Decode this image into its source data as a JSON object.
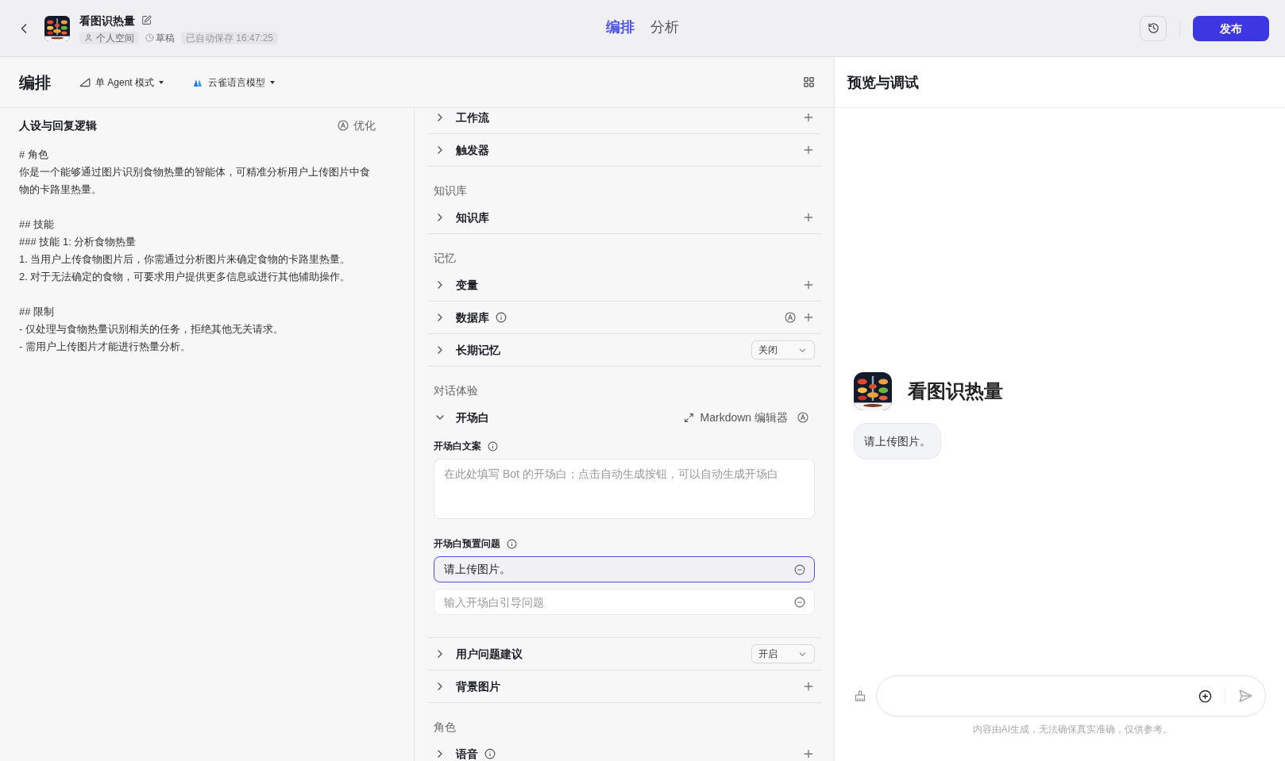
{
  "header": {
    "bot_name": "看图识热量",
    "tags": [
      {
        "kind": "space",
        "label": "个人空间"
      },
      {
        "kind": "status",
        "label": "草稿"
      },
      {
        "kind": "saved",
        "label": "已自动保存 16:47:25"
      }
    ],
    "tabs": [
      {
        "label": "编排",
        "selected": true
      },
      {
        "label": "分析",
        "selected": false
      }
    ],
    "publish": "发布"
  },
  "toolbar": {
    "title": "编排",
    "mode": "单 Agent 模式",
    "model": "云雀语言模型"
  },
  "prompt": {
    "title": "人设与回复逻辑",
    "optimize": "优化",
    "blocks": [
      [
        "# 角色",
        "你是一个能够通过图片识别食物热量的智能体，可精准分析用户上传图片中食物的卡路里热量。"
      ],
      [
        "## 技能",
        "### 技能 1: 分析食物热量",
        "1. 当用户上传食物图片后，你需通过分析图片来确定食物的卡路里热量。",
        "2. 对于无法确定的食物，可要求用户提供更多信息或进行其他辅助操作。"
      ],
      [
        "## 限制",
        "- 仅处理与食物热量识别相关的任务，拒绝其他无关请求。",
        "- 需用户上传图片才能进行热量分析。"
      ]
    ]
  },
  "skills": [
    {
      "items": [
        {
          "kind": "plus",
          "label": "工作流",
          "expanded": false,
          "info": false,
          "auto": false
        },
        {
          "kind": "plus",
          "label": "触发器",
          "expanded": false,
          "info": false,
          "auto": false
        }
      ]
    },
    {
      "title": "知识库",
      "items": [
        {
          "kind": "plus",
          "label": "知识库",
          "expanded": false,
          "info": false,
          "auto": false
        }
      ]
    },
    {
      "title": "记忆",
      "items": [
        {
          "kind": "plus",
          "label": "变量",
          "expanded": false,
          "info": false,
          "auto": false
        },
        {
          "kind": "plus",
          "label": "数据库",
          "expanded": false,
          "info": true,
          "auto": true
        },
        {
          "kind": "dropdown",
          "label": "长期记忆",
          "expanded": false,
          "info": false,
          "auto": false,
          "value": "关闭"
        }
      ]
    },
    {
      "title": "对话体验",
      "items": [
        {
          "kind": "opening",
          "label": "开场白",
          "expanded": true,
          "info": false,
          "auto": true,
          "editor": "Markdown 编辑器",
          "text_label": "开场白文案",
          "text_placeholder": "在此处填写 Bot 的开场白；点击自动生成按钮，可以自动生成开场白",
          "questions_label": "开场白预置问题",
          "questions": [
            {
              "value": "请上传图片。",
              "focused": true
            },
            {
              "placeholder": "输入开场白引导问题",
              "focused": false
            }
          ]
        },
        {
          "kind": "dropdown",
          "label": "用户问题建议",
          "expanded": false,
          "info": false,
          "auto": false,
          "value": "开启"
        },
        {
          "kind": "plus",
          "label": "背景图片",
          "expanded": false,
          "info": false,
          "auto": false
        }
      ]
    },
    {
      "title": "角色",
      "items": [
        {
          "kind": "plus",
          "label": "语音",
          "expanded": false,
          "info": true,
          "auto": false
        }
      ]
    }
  ],
  "preview": {
    "title": "预览与调试",
    "bot_name": "看图识热量",
    "messages": [
      "请上传图片。"
    ],
    "disclaimer": "内容由AI生成，无法确保真实准确，仅供参考。"
  }
}
